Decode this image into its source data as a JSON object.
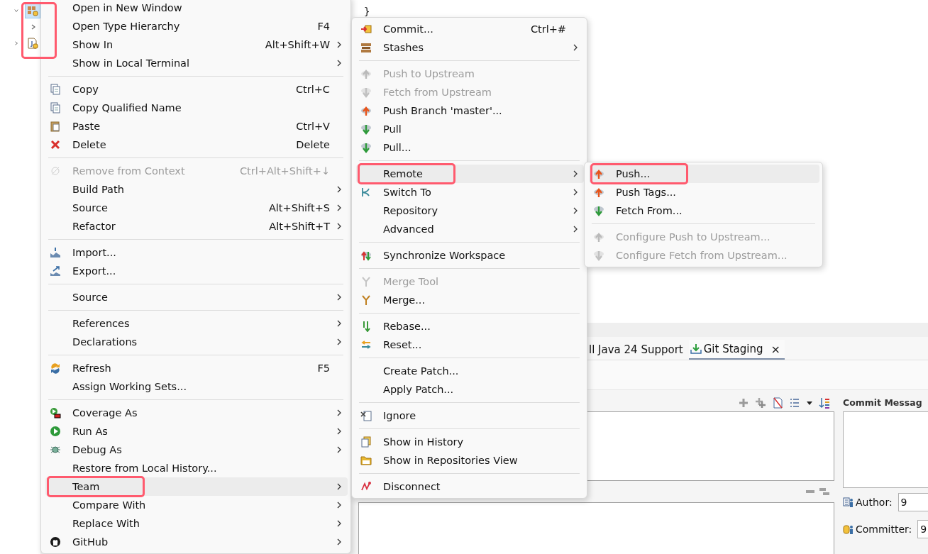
{
  "tree": {
    "highlighted": true,
    "nodes": [
      {
        "expanded": true,
        "selected": true,
        "children": [
          {
            "expanded": false,
            "selected": false
          }
        ]
      },
      {
        "expanded": false,
        "selected": false
      }
    ]
  },
  "editor": {
    "lines": [
      "}"
    ]
  },
  "views": {
    "tabs": [
      {
        "label": "ll Java 24 Support",
        "selected": false,
        "closable": false
      },
      {
        "label": "Git Staging",
        "selected": true,
        "closable": true,
        "close_label": "×"
      }
    ]
  },
  "staging": {
    "commit_message_title": "Commit Messag",
    "author": {
      "label": "Author:",
      "value": "9"
    },
    "committer": {
      "label": "Committer:",
      "value": "9"
    }
  },
  "menus": [
    {
      "items": [
        {
          "kind": "item",
          "label": "Open in New Window",
          "submenu": false,
          "disabled": false,
          "selected": false,
          "highlighted": false
        },
        {
          "kind": "item",
          "label": "Open Type Hierarchy",
          "shortcut": "F4",
          "submenu": false,
          "disabled": false,
          "selected": false,
          "highlighted": false
        },
        {
          "kind": "item",
          "label": "Show In",
          "shortcut": "Alt+Shift+W",
          "submenu": true,
          "disabled": false,
          "selected": false,
          "highlighted": false
        },
        {
          "kind": "item",
          "label": "Show in Local Terminal",
          "submenu": true,
          "disabled": false,
          "selected": false,
          "highlighted": false
        },
        {
          "kind": "separator"
        },
        {
          "kind": "item",
          "label": "Copy",
          "shortcut": "Ctrl+C",
          "submenu": false,
          "disabled": false,
          "selected": false,
          "highlighted": false
        },
        {
          "kind": "item",
          "label": "Copy Qualified Name",
          "submenu": false,
          "disabled": false,
          "selected": false,
          "highlighted": false
        },
        {
          "kind": "item",
          "label": "Paste",
          "shortcut": "Ctrl+V",
          "submenu": false,
          "disabled": false,
          "selected": false,
          "highlighted": false
        },
        {
          "kind": "item",
          "label": "Delete",
          "shortcut": "Delete",
          "submenu": false,
          "disabled": false,
          "selected": false,
          "highlighted": false
        },
        {
          "kind": "separator"
        },
        {
          "kind": "item",
          "label": "Remove from Context",
          "shortcut": "Ctrl+Alt+Shift+↓",
          "submenu": false,
          "disabled": true,
          "selected": false,
          "highlighted": false
        },
        {
          "kind": "item",
          "label": "Build Path",
          "submenu": true,
          "disabled": false,
          "selected": false,
          "highlighted": false
        },
        {
          "kind": "item",
          "label": "Source",
          "shortcut": "Alt+Shift+S",
          "submenu": true,
          "disabled": false,
          "selected": false,
          "highlighted": false
        },
        {
          "kind": "item",
          "label": "Refactor",
          "shortcut": "Alt+Shift+T",
          "submenu": true,
          "disabled": false,
          "selected": false,
          "highlighted": false
        },
        {
          "kind": "separator"
        },
        {
          "kind": "item",
          "label": "Import...",
          "submenu": false,
          "disabled": false,
          "selected": false,
          "highlighted": false
        },
        {
          "kind": "item",
          "label": "Export...",
          "submenu": false,
          "disabled": false,
          "selected": false,
          "highlighted": false
        },
        {
          "kind": "separator"
        },
        {
          "kind": "item",
          "label": "Source",
          "submenu": true,
          "disabled": false,
          "selected": false,
          "highlighted": false
        },
        {
          "kind": "separator"
        },
        {
          "kind": "item",
          "label": "References",
          "submenu": true,
          "disabled": false,
          "selected": false,
          "highlighted": false
        },
        {
          "kind": "item",
          "label": "Declarations",
          "submenu": true,
          "disabled": false,
          "selected": false,
          "highlighted": false
        },
        {
          "kind": "separator"
        },
        {
          "kind": "item",
          "label": "Refresh",
          "shortcut": "F5",
          "submenu": false,
          "disabled": false,
          "selected": false,
          "highlighted": false
        },
        {
          "kind": "item",
          "label": "Assign Working Sets...",
          "submenu": false,
          "disabled": false,
          "selected": false,
          "highlighted": false
        },
        {
          "kind": "separator"
        },
        {
          "kind": "item",
          "label": "Coverage As",
          "submenu": true,
          "disabled": false,
          "selected": false,
          "highlighted": false
        },
        {
          "kind": "item",
          "label": "Run As",
          "submenu": true,
          "disabled": false,
          "selected": false,
          "highlighted": false
        },
        {
          "kind": "item",
          "label": "Debug As",
          "submenu": true,
          "disabled": false,
          "selected": false,
          "highlighted": false
        },
        {
          "kind": "item",
          "label": "Restore from Local History...",
          "submenu": false,
          "disabled": false,
          "selected": false,
          "highlighted": false
        },
        {
          "kind": "item",
          "label": "Team",
          "submenu": true,
          "disabled": false,
          "selected": true,
          "highlighted": true
        },
        {
          "kind": "item",
          "label": "Compare With",
          "submenu": true,
          "disabled": false,
          "selected": false,
          "highlighted": false
        },
        {
          "kind": "item",
          "label": "Replace With",
          "submenu": true,
          "disabled": false,
          "selected": false,
          "highlighted": false
        },
        {
          "kind": "item",
          "label": "GitHub",
          "submenu": true,
          "disabled": false,
          "selected": false,
          "highlighted": false
        }
      ]
    },
    {
      "items": [
        {
          "kind": "item",
          "label": "Commit...",
          "shortcut": "Ctrl+#",
          "submenu": false,
          "disabled": false,
          "selected": false,
          "highlighted": false
        },
        {
          "kind": "item",
          "label": "Stashes",
          "submenu": true,
          "disabled": false,
          "selected": false,
          "highlighted": false
        },
        {
          "kind": "separator"
        },
        {
          "kind": "item",
          "label": "Push to Upstream",
          "submenu": false,
          "disabled": true,
          "selected": false,
          "highlighted": false
        },
        {
          "kind": "item",
          "label": "Fetch from Upstream",
          "submenu": false,
          "disabled": true,
          "selected": false,
          "highlighted": false
        },
        {
          "kind": "item",
          "label": "Push Branch 'master'...",
          "submenu": false,
          "disabled": false,
          "selected": false,
          "highlighted": false
        },
        {
          "kind": "item",
          "label": "Pull",
          "submenu": false,
          "disabled": false,
          "selected": false,
          "highlighted": false
        },
        {
          "kind": "item",
          "label": "Pull...",
          "submenu": false,
          "disabled": false,
          "selected": false,
          "highlighted": false
        },
        {
          "kind": "separator"
        },
        {
          "kind": "item",
          "label": "Remote",
          "submenu": true,
          "disabled": false,
          "selected": true,
          "highlighted": true
        },
        {
          "kind": "item",
          "label": "Switch To",
          "submenu": true,
          "disabled": false,
          "selected": false,
          "highlighted": false
        },
        {
          "kind": "item",
          "label": "Repository",
          "submenu": true,
          "disabled": false,
          "selected": false,
          "highlighted": false
        },
        {
          "kind": "item",
          "label": "Advanced",
          "submenu": true,
          "disabled": false,
          "selected": false,
          "highlighted": false
        },
        {
          "kind": "separator"
        },
        {
          "kind": "item",
          "label": "Synchronize Workspace",
          "submenu": false,
          "disabled": false,
          "selected": false,
          "highlighted": false
        },
        {
          "kind": "separator"
        },
        {
          "kind": "item",
          "label": "Merge Tool",
          "submenu": false,
          "disabled": true,
          "selected": false,
          "highlighted": false
        },
        {
          "kind": "item",
          "label": "Merge...",
          "submenu": false,
          "disabled": false,
          "selected": false,
          "highlighted": false
        },
        {
          "kind": "separator"
        },
        {
          "kind": "item",
          "label": "Rebase...",
          "submenu": false,
          "disabled": false,
          "selected": false,
          "highlighted": false
        },
        {
          "kind": "item",
          "label": "Reset...",
          "submenu": false,
          "disabled": false,
          "selected": false,
          "highlighted": false
        },
        {
          "kind": "separator"
        },
        {
          "kind": "item",
          "label": "Create Patch...",
          "submenu": false,
          "disabled": false,
          "selected": false,
          "highlighted": false
        },
        {
          "kind": "item",
          "label": "Apply Patch...",
          "submenu": false,
          "disabled": false,
          "selected": false,
          "highlighted": false
        },
        {
          "kind": "separator"
        },
        {
          "kind": "item",
          "label": "Ignore",
          "submenu": false,
          "disabled": false,
          "selected": false,
          "highlighted": false
        },
        {
          "kind": "separator"
        },
        {
          "kind": "item",
          "label": "Show in History",
          "submenu": false,
          "disabled": false,
          "selected": false,
          "highlighted": false
        },
        {
          "kind": "item",
          "label": "Show in Repositories View",
          "submenu": false,
          "disabled": false,
          "selected": false,
          "highlighted": false
        },
        {
          "kind": "separator"
        },
        {
          "kind": "item",
          "label": "Disconnect",
          "submenu": false,
          "disabled": false,
          "selected": false,
          "highlighted": false
        }
      ]
    },
    {
      "items": [
        {
          "kind": "item",
          "label": "Push...",
          "submenu": false,
          "disabled": false,
          "selected": true,
          "highlighted": true
        },
        {
          "kind": "item",
          "label": "Push Tags...",
          "submenu": false,
          "disabled": false,
          "selected": false,
          "highlighted": false
        },
        {
          "kind": "item",
          "label": "Fetch From...",
          "submenu": false,
          "disabled": false,
          "selected": false,
          "highlighted": false
        },
        {
          "kind": "separator"
        },
        {
          "kind": "item",
          "label": "Configure Push to Upstream...",
          "submenu": false,
          "disabled": true,
          "selected": false,
          "highlighted": false
        },
        {
          "kind": "item",
          "label": "Configure Fetch from Upstream...",
          "submenu": false,
          "disabled": true,
          "selected": false,
          "highlighted": false
        }
      ]
    }
  ]
}
